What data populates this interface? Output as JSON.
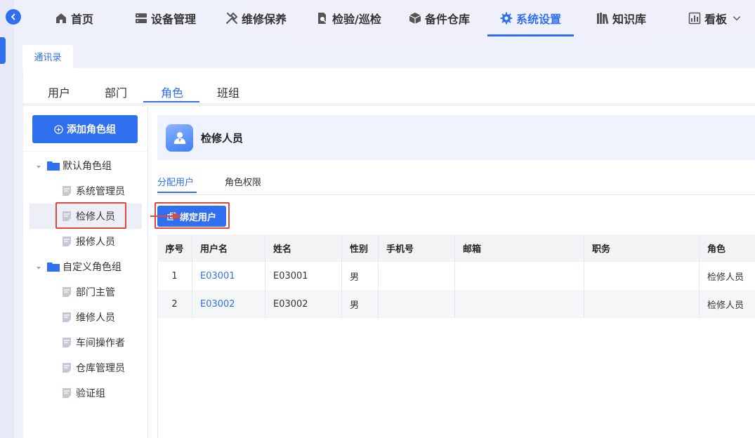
{
  "nav": {
    "items": [
      {
        "label": "首页",
        "icon": "home-icon"
      },
      {
        "label": "设备管理",
        "icon": "device-icon"
      },
      {
        "label": "维修保养",
        "icon": "tools-icon"
      },
      {
        "label": "检验/巡检",
        "icon": "inspect-icon"
      },
      {
        "label": "备件仓库",
        "icon": "box-icon"
      },
      {
        "label": "系统设置",
        "icon": "gear-icon",
        "active": true
      },
      {
        "label": "知识库",
        "icon": "books-icon"
      },
      {
        "label": "看板",
        "icon": "dashboard-icon"
      }
    ]
  },
  "page_tab": "通讯录",
  "subtabs": [
    "用户",
    "部门",
    "角色",
    "班组"
  ],
  "active_subtab": "角色",
  "add_group_label": "添加角色组",
  "tree": {
    "groups": [
      {
        "label": "默认角色组",
        "items": [
          "系统管理员",
          "检修人员",
          "报修人员"
        ]
      },
      {
        "label": "自定义角色组",
        "items": [
          "部门主管",
          "维修人员",
          "车间操作者",
          "仓库管理员",
          "验证组"
        ]
      }
    ],
    "selected": "检修人员"
  },
  "role": {
    "title": "检修人员"
  },
  "inner_tabs": [
    "分配用户",
    "角色权限"
  ],
  "bind_button": "绑定用户",
  "table": {
    "columns": [
      "序号",
      "用户名",
      "姓名",
      "性别",
      "手机号",
      "邮箱",
      "职务",
      "角色"
    ],
    "rows": [
      [
        "1",
        "E03001",
        "E03001",
        "男",
        "",
        "",
        "",
        "检修人员"
      ],
      [
        "2",
        "E03002",
        "E03002",
        "男",
        "",
        "",
        "",
        "检修人员"
      ]
    ]
  },
  "colors": {
    "accent": "#2f6ff0",
    "highlight": "#e2473b"
  }
}
